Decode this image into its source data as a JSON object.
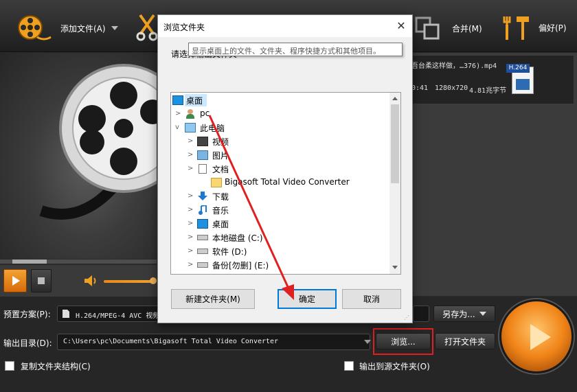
{
  "toolbar": {
    "add_file": "添加文件(A)",
    "merge": "合并(M)",
    "preferences": "偏好(P)"
  },
  "file_list": {
    "item": {
      "name": "吾台柔这样做，…376).mp4",
      "codec_badge": "H.264",
      "duration": "0:41",
      "resolution": "1280x720",
      "size": "4.81兆字节"
    }
  },
  "bottom": {
    "preset_label": "预置方案(P):",
    "preset_value": "H.264/MPEG-4 AVC 视频",
    "save_as": "另存为...",
    "output_label": "输出目录(D):",
    "output_value": "C:\\Users\\pc\\Documents\\Bigasoft Total Video Converter",
    "browse": "浏览...",
    "open_folder": "打开文件夹",
    "copy_structure": "复制文件夹结构(C)",
    "output_to_source": "输出到源文件夹(O)"
  },
  "dialog": {
    "title": "浏览文件夹",
    "close": "✕",
    "instruction": "请选择输出文件夹",
    "tooltip": "显示桌面上的文件、文件夹、程序快捷方式和其他项目。",
    "tree": {
      "desktop": "桌面",
      "pc_user": "pc",
      "this_pc": "此电脑",
      "videos": "视频",
      "pictures": "图片",
      "documents": "文档",
      "bigasoft": "Bigasoft Total Video Converter",
      "downloads": "下载",
      "music": "音乐",
      "desktop2": "桌面",
      "local_disk": "本地磁盘 (C:)",
      "software": "软件 (D:)",
      "backup": "备份[勿删] (E:)",
      "partial": "文档"
    },
    "new_folder": "新建文件夹(M)",
    "ok": "确定",
    "cancel": "取消"
  },
  "colors": {
    "accent_orange": "#f08418",
    "annotation_red": "#e02020",
    "dialog_default_blue": "#0078d7"
  }
}
